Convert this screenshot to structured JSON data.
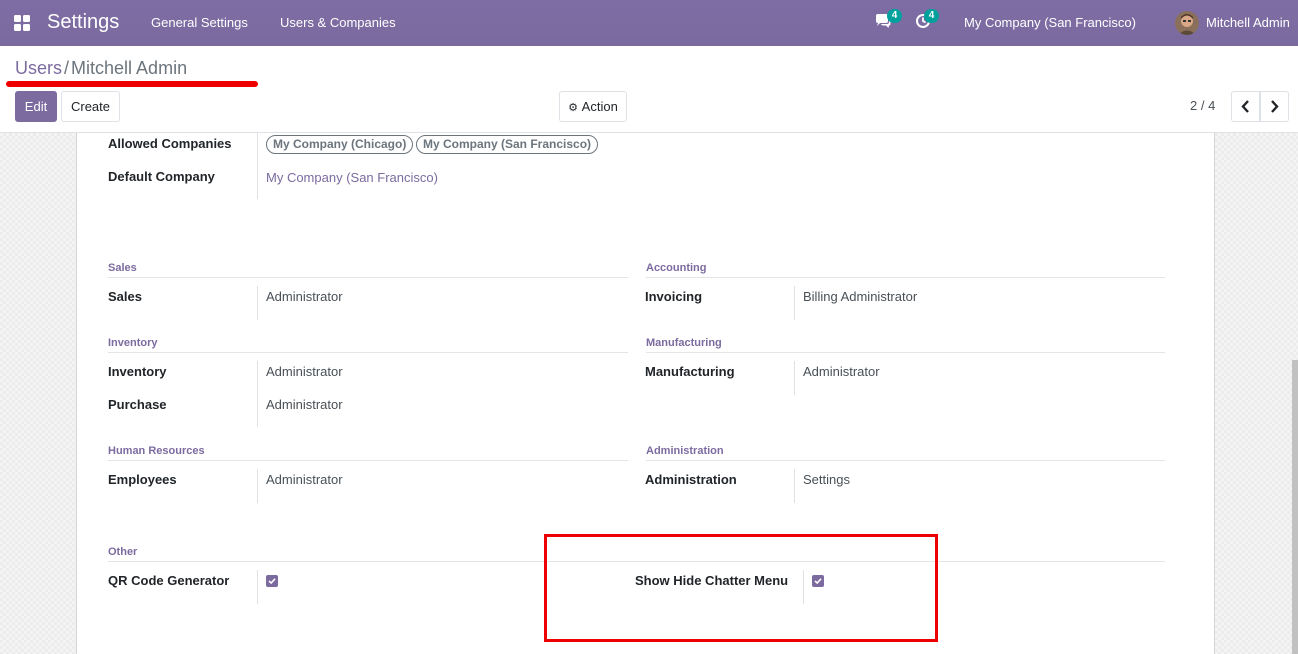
{
  "navbar": {
    "brand": "Settings",
    "menu": [
      "General Settings",
      "Users & Companies"
    ],
    "messages_count": "4",
    "activities_count": "4",
    "company": "My Company (San Francisco)",
    "user": "Mitchell Admin"
  },
  "breadcrumb": {
    "parent": "Users",
    "separator": "/",
    "current": "Mitchell Admin"
  },
  "buttons": {
    "edit": "Edit",
    "create": "Create",
    "action": "Action"
  },
  "pager": {
    "value": "2 / 4"
  },
  "colors": {
    "brand": "#7c6b9f",
    "badge": "#00a09d",
    "highlight": "#ee0000"
  },
  "form": {
    "allowed_companies": {
      "label": "Allowed Companies",
      "tags": [
        "My Company (Chicago)",
        "My Company (San Francisco)"
      ]
    },
    "default_company": {
      "label": "Default Company",
      "value": "My Company (San Francisco)"
    },
    "groups": {
      "sales": {
        "title": "Sales",
        "fields": [
          {
            "label": "Sales",
            "value": "Administrator"
          }
        ]
      },
      "accounting": {
        "title": "Accounting",
        "fields": [
          {
            "label": "Invoicing",
            "value": "Billing Administrator"
          }
        ]
      },
      "inventory": {
        "title": "Inventory",
        "fields": [
          {
            "label": "Inventory",
            "value": "Administrator"
          },
          {
            "label": "Purchase",
            "value": "Administrator"
          }
        ]
      },
      "manufacturing": {
        "title": "Manufacturing",
        "fields": [
          {
            "label": "Manufacturing",
            "value": "Administrator"
          }
        ]
      },
      "hr": {
        "title": "Human Resources",
        "fields": [
          {
            "label": "Employees",
            "value": "Administrator"
          }
        ]
      },
      "administration": {
        "title": "Administration",
        "fields": [
          {
            "label": "Administration",
            "value": "Settings"
          }
        ]
      },
      "other": {
        "title": "Other",
        "qr_label": "QR Code Generator",
        "qr_checked": true,
        "chatter_label": "Show Hide Chatter Menu",
        "chatter_checked": true
      }
    }
  }
}
